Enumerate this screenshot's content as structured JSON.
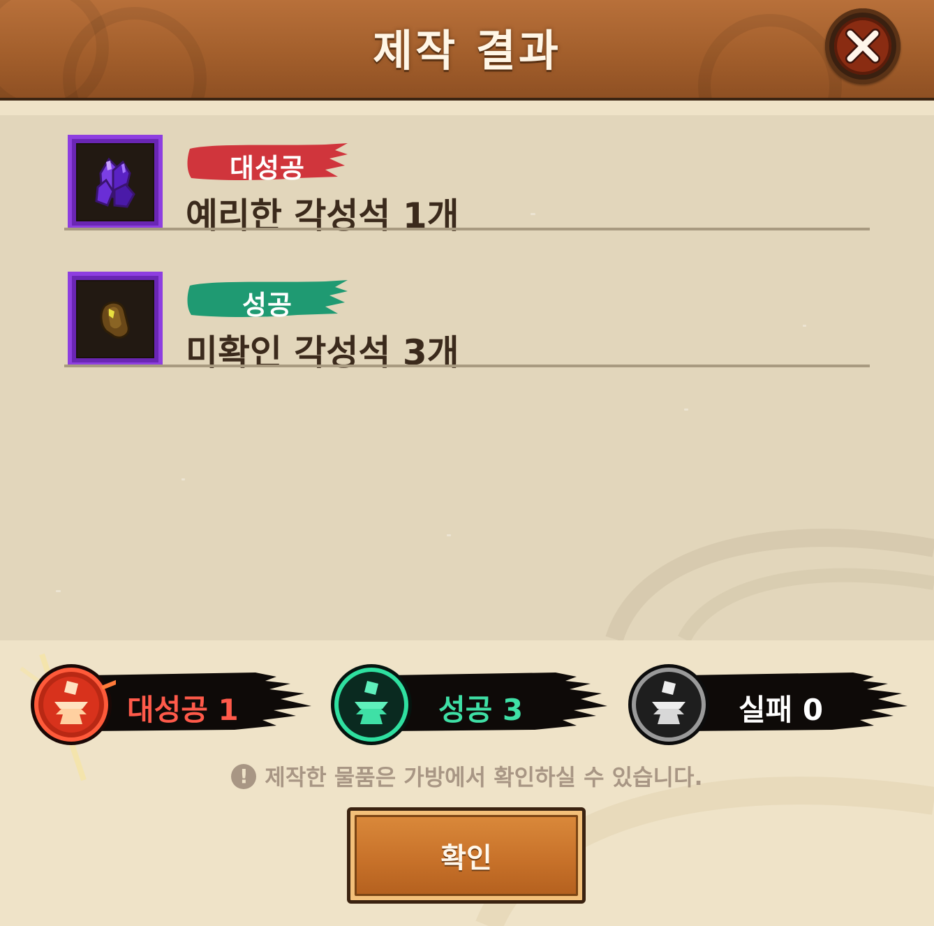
{
  "dialog": {
    "title": "제작 결과"
  },
  "results": [
    {
      "grade": "대성공",
      "grade_color": "#d0353c",
      "item": "예리한 각성석 1개",
      "icon": "purple-crystal-icon"
    },
    {
      "grade": "성공",
      "grade_color": "#1f9a72",
      "item": "미확인 각성석 3개",
      "icon": "brown-stone-icon"
    }
  ],
  "summary": {
    "great_success": {
      "label": "대성공 1",
      "color": "#ff5a4a"
    },
    "success": {
      "label": "성공 3",
      "color": "#3fe0a6"
    },
    "fail": {
      "label": "실패 0",
      "color": "#ffffff"
    }
  },
  "notice": {
    "text": "제작한 물품은 가방에서 확인하실 수 있습니다."
  },
  "confirm_button": {
    "label": "확인"
  }
}
